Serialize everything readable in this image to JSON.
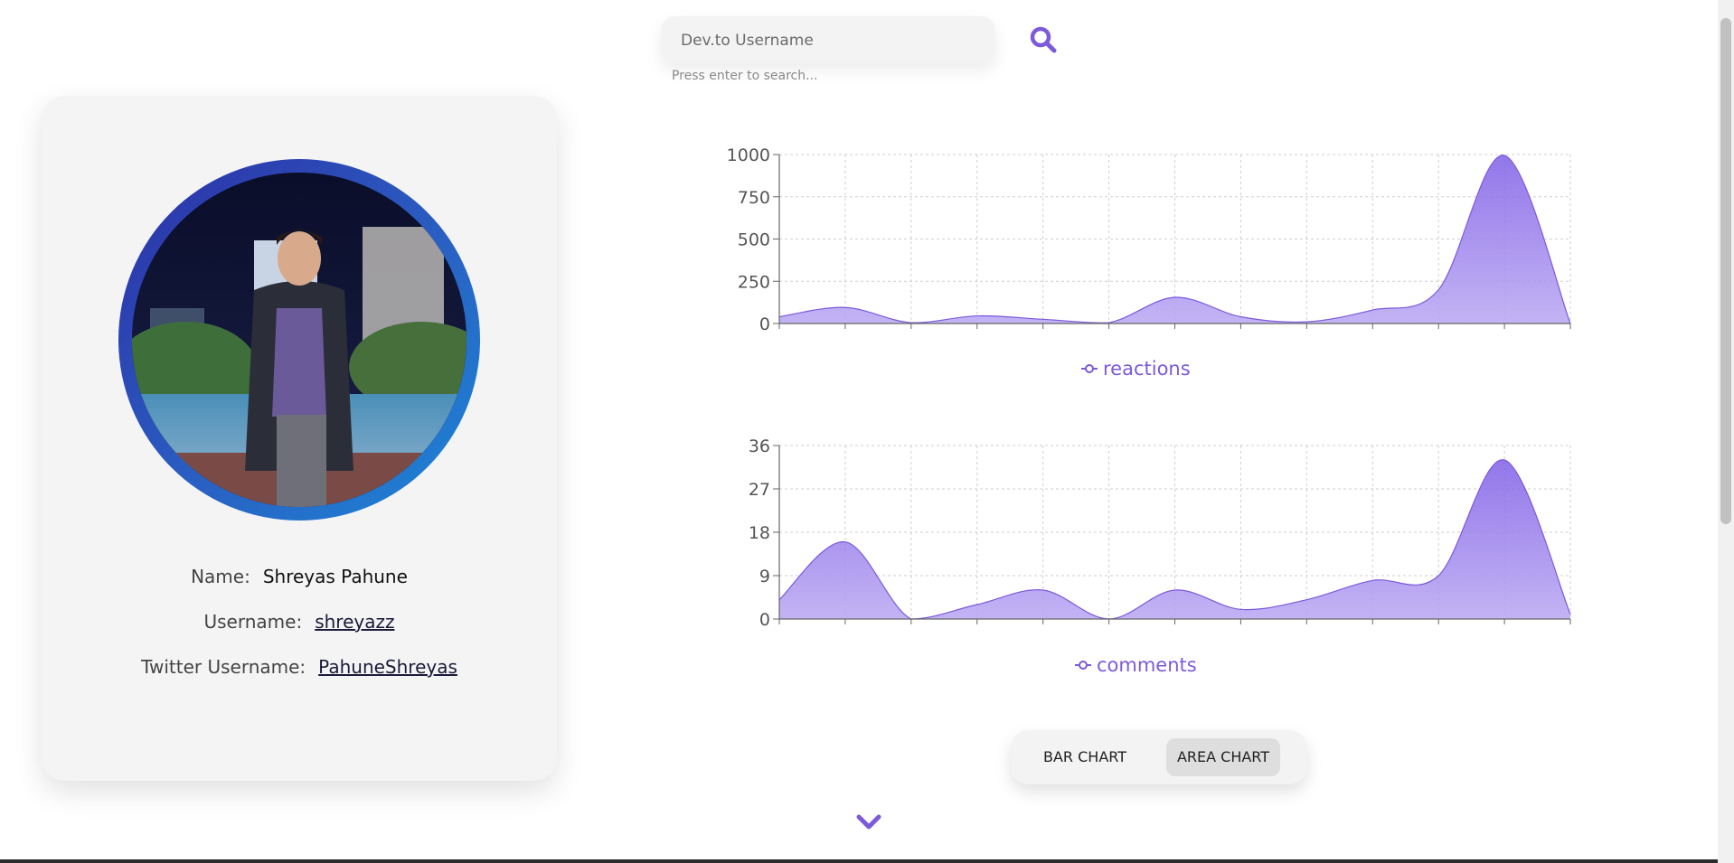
{
  "search": {
    "placeholder": "Dev.to Username",
    "hint": "Press enter to search..."
  },
  "icons": {
    "search": "search-icon",
    "chevron": "chevron-down-icon",
    "legend": "line-marker-icon"
  },
  "colors": {
    "accent": "#7c5ad9",
    "area_fill_top": "#8a6ce8",
    "area_fill_bottom": "#b5a3f0",
    "avatar_ring": "#2a5fc2"
  },
  "profile": {
    "name_label": "Name:",
    "name": "Shreyas Pahune",
    "username_label": "Username:",
    "username": "shreyazz",
    "twitter_label": "Twitter Username:",
    "twitter": "PahuneShreyas"
  },
  "toggle": {
    "bar_label": "BAR CHART",
    "area_label": "AREA CHART",
    "active": "area"
  },
  "chart_data": [
    {
      "type": "area",
      "series": [
        {
          "name": "reactions",
          "values": [
            40,
            95,
            5,
            45,
            25,
            5,
            155,
            40,
            10,
            80,
            200,
            995,
            0
          ]
        }
      ],
      "yticks": [
        0,
        250,
        500,
        750,
        1000
      ],
      "ylim": [
        0,
        1000
      ],
      "grid": true,
      "legend": "bottom"
    },
    {
      "type": "area",
      "series": [
        {
          "name": "comments",
          "values": [
            4,
            16,
            0,
            3,
            6,
            0,
            6,
            2,
            4,
            8,
            9,
            33,
            1
          ]
        }
      ],
      "yticks": [
        0,
        9,
        18,
        27,
        36
      ],
      "ylim": [
        0,
        36
      ],
      "grid": true,
      "legend": "bottom"
    }
  ]
}
